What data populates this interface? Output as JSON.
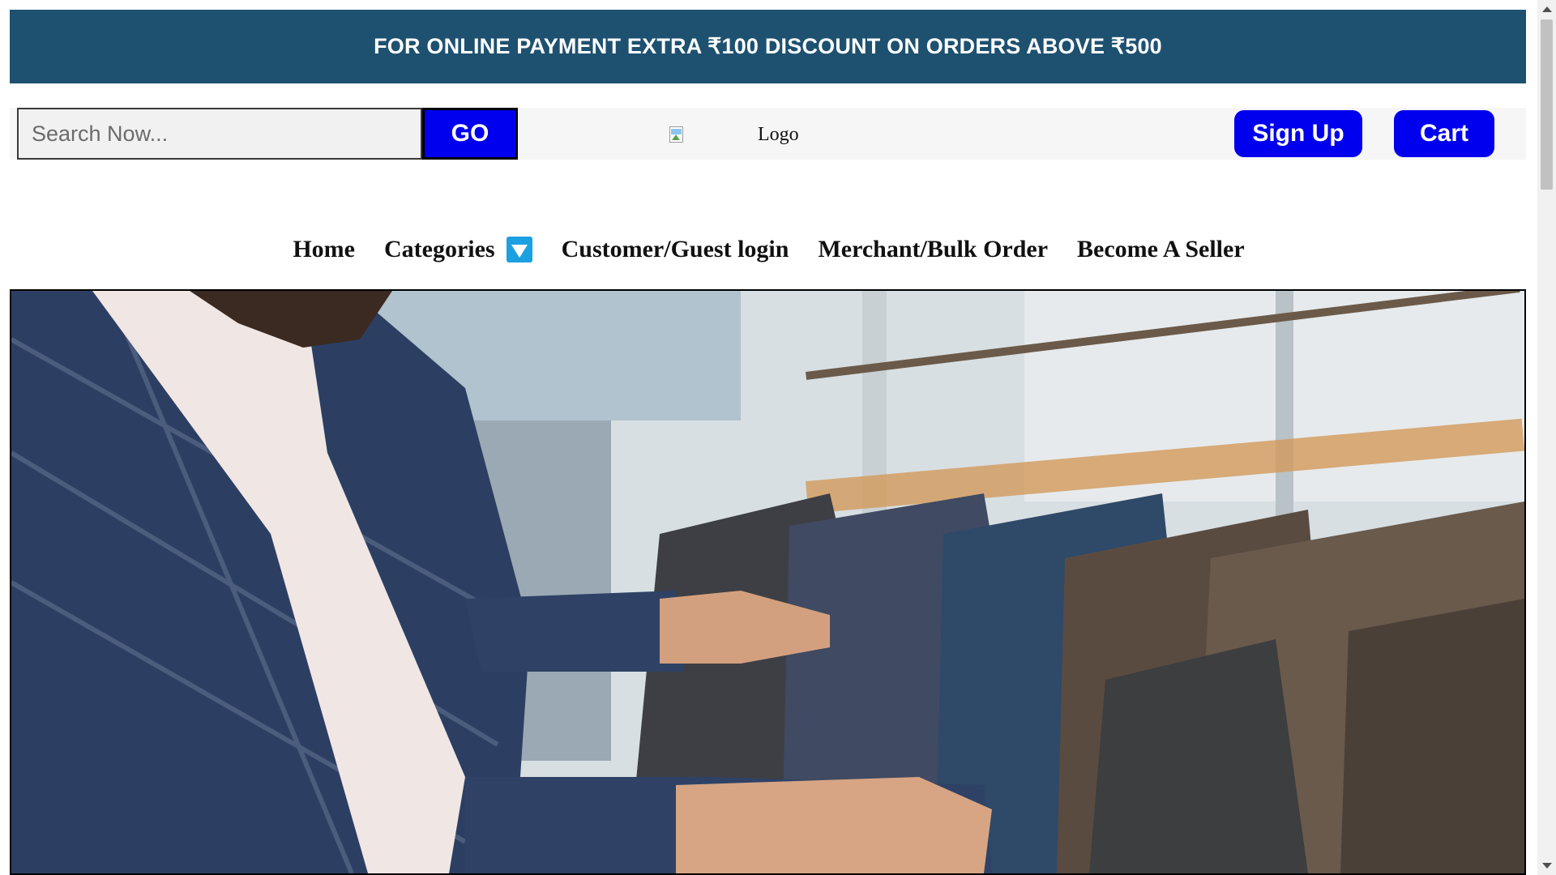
{
  "promo": {
    "text": "FOR ONLINE PAYMENT EXTRA ₹100 DISCOUNT ON ORDERS ABOVE ₹500"
  },
  "header": {
    "search_placeholder": "Search Now...",
    "go_label": "GO",
    "logo_alt": "Logo",
    "signup_label": "Sign Up",
    "cart_label": "Cart"
  },
  "nav": {
    "items": [
      {
        "label": "Home"
      },
      {
        "label": "Categories",
        "icon": "dropdown-triangle-icon"
      },
      {
        "label": "Customer/Guest login"
      },
      {
        "label": "Merchant/Bulk Order"
      },
      {
        "label": "Become A Seller"
      }
    ]
  },
  "hero": {
    "image": "man-browsing-suits-on-rack-photo"
  },
  "colors": {
    "banner": "#1e5170",
    "button": "#0000ee",
    "dropdown_icon": "#1ba1e2"
  }
}
